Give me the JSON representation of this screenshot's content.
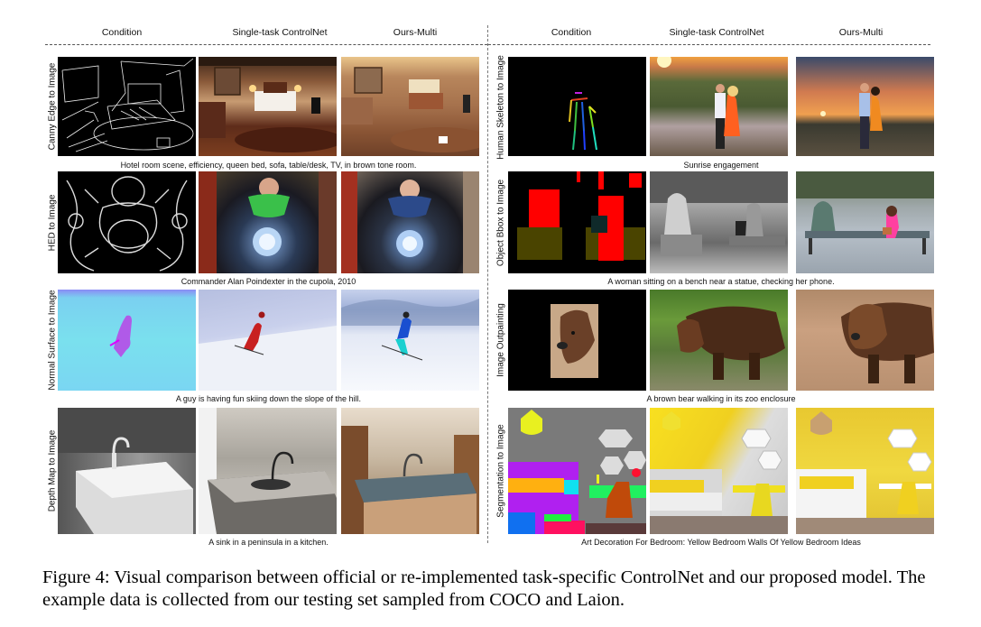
{
  "column_headers": {
    "left": [
      "Condition",
      "Single-task ControlNet",
      "Ours-Multi"
    ],
    "right": [
      "Condition",
      "Single-task ControlNet",
      "Ours-Multi"
    ]
  },
  "rows_left": [
    {
      "label": "Canny Edge to Image",
      "caption": "Hotel room scene, efficiency, queen bed, sofa, table/desk, TV, in brown tone room.",
      "images": [
        "canny edge map of hotel room",
        "hotel room generated by single-task ControlNet",
        "hotel room generated by Ours-Multi"
      ]
    },
    {
      "label": "HED to Image",
      "caption": "Commander Alan Poindexter in the cupola, 2010",
      "images": [
        "HED soft edge map of astronaut in cupola",
        "astronaut in cupola by single-task ControlNet",
        "astronaut in cupola by Ours-Multi"
      ]
    },
    {
      "label": "Normal Surface to Image",
      "caption": "A guy is having fun skiing down the slope of the hill.",
      "images": [
        "normal map of skier",
        "skier in red by single-task ControlNet",
        "skier in blue by Ours-Multi"
      ]
    },
    {
      "label": "Depth Map to Image",
      "caption": "A sink in a peninsula in a kitchen.",
      "images": [
        "depth map of kitchen sink",
        "kitchen sink by single-task ControlNet",
        "kitchen sink by Ours-Multi"
      ]
    }
  ],
  "rows_right": [
    {
      "label": "Human Skeleton to Image",
      "caption": "Sunrise engagement",
      "images": [
        "openpose skeleton of couple",
        "couple at sunrise by single-task ControlNet",
        "couple at sunrise by Ours-Multi"
      ]
    },
    {
      "label": "Object Bbox to Image",
      "caption": "A woman sitting on a bench near a statue, checking her phone.",
      "images": [
        "object bounding box map",
        "statue and woman on bench by single-task ControlNet",
        "statue and woman on bench by Ours-Multi"
      ]
    },
    {
      "label": "Image Outpainting",
      "caption": "A brown bear walking in its zoo enclosure",
      "images": [
        "cropped bear image on black",
        "brown bear by single-task ControlNet",
        "brown bear by Ours-Multi"
      ]
    },
    {
      "label": "Segmentation to Image",
      "caption": "Art Decoration For Bedroom: Yellow Bedroom Walls Of Yellow Bedroom Ideas",
      "images": [
        "segmentation map of bedroom",
        "yellow bedroom by single-task ControlNet",
        "yellow bedroom by Ours-Multi"
      ]
    }
  ],
  "figure_caption": "Figure 4: Visual comparison between official or re-implemented task-specific ControlNet and our proposed model. The example data is collected from our testing set sampled from COCO and Laion."
}
